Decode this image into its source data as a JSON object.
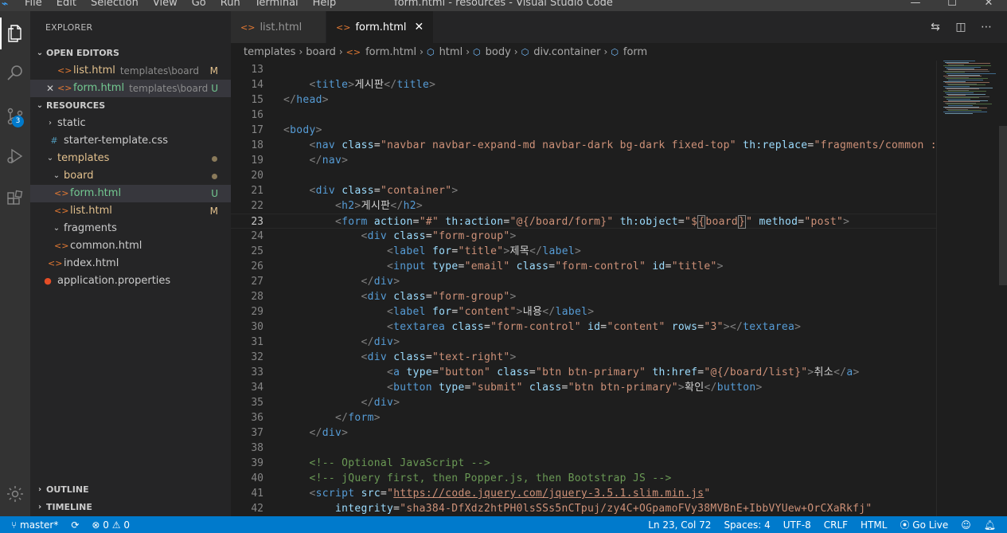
{
  "window": {
    "title": "form.html - resources - Visual Studio Code",
    "menu": [
      "File",
      "Edit",
      "Selection",
      "View",
      "Go",
      "Run",
      "Terminal",
      "Help"
    ]
  },
  "activity_bar": {
    "scm_badge": "3"
  },
  "explorer": {
    "title": "EXPLORER",
    "open_editors_label": "OPEN EDITORS",
    "open_editors": [
      {
        "name": "list.html",
        "desc": "templates\\board",
        "status": "M"
      },
      {
        "name": "form.html",
        "desc": "templates\\board",
        "status": "U"
      }
    ],
    "folder_label": "RESOURCES",
    "tree": {
      "static": "static",
      "starter_css": "starter-template.css",
      "templates": "templates",
      "board": "board",
      "form": "form.html",
      "form_status": "U",
      "list": "list.html",
      "list_status": "M",
      "fragments": "fragments",
      "common": "common.html",
      "index": "index.html",
      "app_props": "application.properties"
    },
    "outline_label": "OUTLINE",
    "timeline_label": "TIMELINE"
  },
  "tabs": [
    {
      "label": "list.html"
    },
    {
      "label": "form.html"
    }
  ],
  "breadcrumb": [
    "templates",
    "board",
    "form.html",
    "html",
    "body",
    "div.container",
    "form"
  ],
  "editor": {
    "lines": [
      {
        "n": "13",
        "html": ""
      },
      {
        "n": "14",
        "html": "    <span class='b'>&lt;</span><span class='t'>title</span><span class='b'>&gt;</span><span class='x'>게시판</span><span class='b'>&lt;/</span><span class='t'>title</span><span class='b'>&gt;</span>"
      },
      {
        "n": "15",
        "html": "<span class='b'>&lt;/</span><span class='t'>head</span><span class='b'>&gt;</span>"
      },
      {
        "n": "16",
        "html": ""
      },
      {
        "n": "17",
        "html": "<span class='b'>&lt;</span><span class='t'>body</span><span class='b'>&gt;</span>"
      },
      {
        "n": "18",
        "html": "    <span class='b'>&lt;</span><span class='t'>nav</span> <span class='a'>class</span><span class='x'>=</span><span class='s'>\"navbar navbar-expand-md navbar-dark bg-dark fixed-top\"</span> <span class='a'>th:replace</span><span class='x'>=</span><span class='s'>\"fragments/common :: menu</span>"
      },
      {
        "n": "19",
        "html": "    <span class='b'>&lt;/</span><span class='t'>nav</span><span class='b'>&gt;</span>"
      },
      {
        "n": "20",
        "html": ""
      },
      {
        "n": "21",
        "html": "    <span class='b'>&lt;</span><span class='t'>div</span> <span class='a'>class</span><span class='x'>=</span><span class='s'>\"container\"</span><span class='b'>&gt;</span>"
      },
      {
        "n": "22",
        "html": "        <span class='b'>&lt;</span><span class='t'>h2</span><span class='b'>&gt;</span><span class='x'>게시판</span><span class='b'>&lt;/</span><span class='t'>h2</span><span class='b'>&gt;</span>"
      },
      {
        "n": "23",
        "html": "        <span class='b'>&lt;</span><span class='t'>form</span> <span class='a'>action</span><span class='x'>=</span><span class='s'>\"#\"</span> <span class='a'>th:action</span><span class='x'>=</span><span class='s'>\"@{/board/form}\"</span> <span class='a'>th:object</span><span class='x'>=</span><span class='s'>\"$<span class='hl'>{</span>board<span class='hl'>}</span>\"</span> <span class='a'>method</span><span class='x'>=</span><span class='s'>\"post\"</span><span class='b'>&gt;</span>",
        "cur": true
      },
      {
        "n": "24",
        "html": "            <span class='b'>&lt;</span><span class='t'>div</span> <span class='a'>class</span><span class='x'>=</span><span class='s'>\"form-group\"</span><span class='b'>&gt;</span>"
      },
      {
        "n": "25",
        "html": "                <span class='b'>&lt;</span><span class='t'>label</span> <span class='a'>for</span><span class='x'>=</span><span class='s'>\"title\"</span><span class='b'>&gt;</span><span class='x'>제목</span><span class='b'>&lt;/</span><span class='t'>label</span><span class='b'>&gt;</span>"
      },
      {
        "n": "26",
        "html": "                <span class='b'>&lt;</span><span class='t'>input</span> <span class='a'>type</span><span class='x'>=</span><span class='s'>\"email\"</span> <span class='a'>class</span><span class='x'>=</span><span class='s'>\"form-control\"</span> <span class='a'>id</span><span class='x'>=</span><span class='s'>\"title\"</span><span class='b'>&gt;</span>"
      },
      {
        "n": "27",
        "html": "            <span class='b'>&lt;/</span><span class='t'>div</span><span class='b'>&gt;</span>"
      },
      {
        "n": "28",
        "html": "            <span class='b'>&lt;</span><span class='t'>div</span> <span class='a'>class</span><span class='x'>=</span><span class='s'>\"form-group\"</span><span class='b'>&gt;</span>"
      },
      {
        "n": "29",
        "html": "                <span class='b'>&lt;</span><span class='t'>label</span> <span class='a'>for</span><span class='x'>=</span><span class='s'>\"content\"</span><span class='b'>&gt;</span><span class='x'>내용</span><span class='b'>&lt;/</span><span class='t'>label</span><span class='b'>&gt;</span>"
      },
      {
        "n": "30",
        "html": "                <span class='b'>&lt;</span><span class='t'>textarea</span> <span class='a'>class</span><span class='x'>=</span><span class='s'>\"form-control\"</span> <span class='a'>id</span><span class='x'>=</span><span class='s'>\"content\"</span> <span class='a'>rows</span><span class='x'>=</span><span class='s'>\"3\"</span><span class='b'>&gt;&lt;/</span><span class='t'>textarea</span><span class='b'>&gt;</span>"
      },
      {
        "n": "31",
        "html": "            <span class='b'>&lt;/</span><span class='t'>div</span><span class='b'>&gt;</span>"
      },
      {
        "n": "32",
        "html": "            <span class='b'>&lt;</span><span class='t'>div</span> <span class='a'>class</span><span class='x'>=</span><span class='s'>\"text-right\"</span><span class='b'>&gt;</span>"
      },
      {
        "n": "33",
        "html": "                <span class='b'>&lt;</span><span class='t'>a</span> <span class='a'>type</span><span class='x'>=</span><span class='s'>\"button\"</span> <span class='a'>class</span><span class='x'>=</span><span class='s'>\"btn btn-primary\"</span> <span class='a'>th:href</span><span class='x'>=</span><span class='s'>\"@{/board/list}\"</span><span class='b'>&gt;</span><span class='x'>취소</span><span class='b'>&lt;/</span><span class='t'>a</span><span class='b'>&gt;</span>"
      },
      {
        "n": "34",
        "html": "                <span class='b'>&lt;</span><span class='t'>button</span> <span class='a'>type</span><span class='x'>=</span><span class='s'>\"submit\"</span> <span class='a'>class</span><span class='x'>=</span><span class='s'>\"btn btn-primary\"</span><span class='b'>&gt;</span><span class='x'>확인</span><span class='b'>&lt;/</span><span class='t'>button</span><span class='b'>&gt;</span>"
      },
      {
        "n": "35",
        "html": "            <span class='b'>&lt;/</span><span class='t'>div</span><span class='b'>&gt;</span>"
      },
      {
        "n": "36",
        "html": "        <span class='b'>&lt;/</span><span class='t'>form</span><span class='b'>&gt;</span>"
      },
      {
        "n": "37",
        "html": "    <span class='b'>&lt;/</span><span class='t'>div</span><span class='b'>&gt;</span>"
      },
      {
        "n": "38",
        "html": ""
      },
      {
        "n": "39",
        "html": "    <span class='cm'>&lt;!-- Optional JavaScript --&gt;</span>"
      },
      {
        "n": "40",
        "html": "    <span class='cm'>&lt;!-- jQuery first, then Popper.js, then Bootstrap JS --&gt;</span>"
      },
      {
        "n": "41",
        "html": "    <span class='b'>&lt;</span><span class='t'>script</span> <span class='a'>src</span><span class='x'>=</span><span class='s'>\"</span><span class='u'>https://code.jquery.com/jquery-3.5.1.slim.min.js</span><span class='s'>\"</span>"
      },
      {
        "n": "42",
        "html": "        <span class='a'>integrity</span><span class='x'>=</span><span class='s'>\"sha384-DfXdz2htPH0lsSSs5nCTpuj/zy4C+OGpamoFVy38MVBnE+IbbVYUew+OrCXaRkfj\"</span>"
      }
    ]
  },
  "statusbar": {
    "branch": "master*",
    "errors": "0",
    "warnings": "0",
    "position": "Ln 23, Col 72",
    "spaces": "Spaces: 4",
    "encoding": "UTF-8",
    "eol": "CRLF",
    "language": "HTML",
    "golive": "Go Live"
  },
  "colors": {
    "accent": "#007acc",
    "modified": "#e2c08d",
    "untracked": "#73c991"
  }
}
